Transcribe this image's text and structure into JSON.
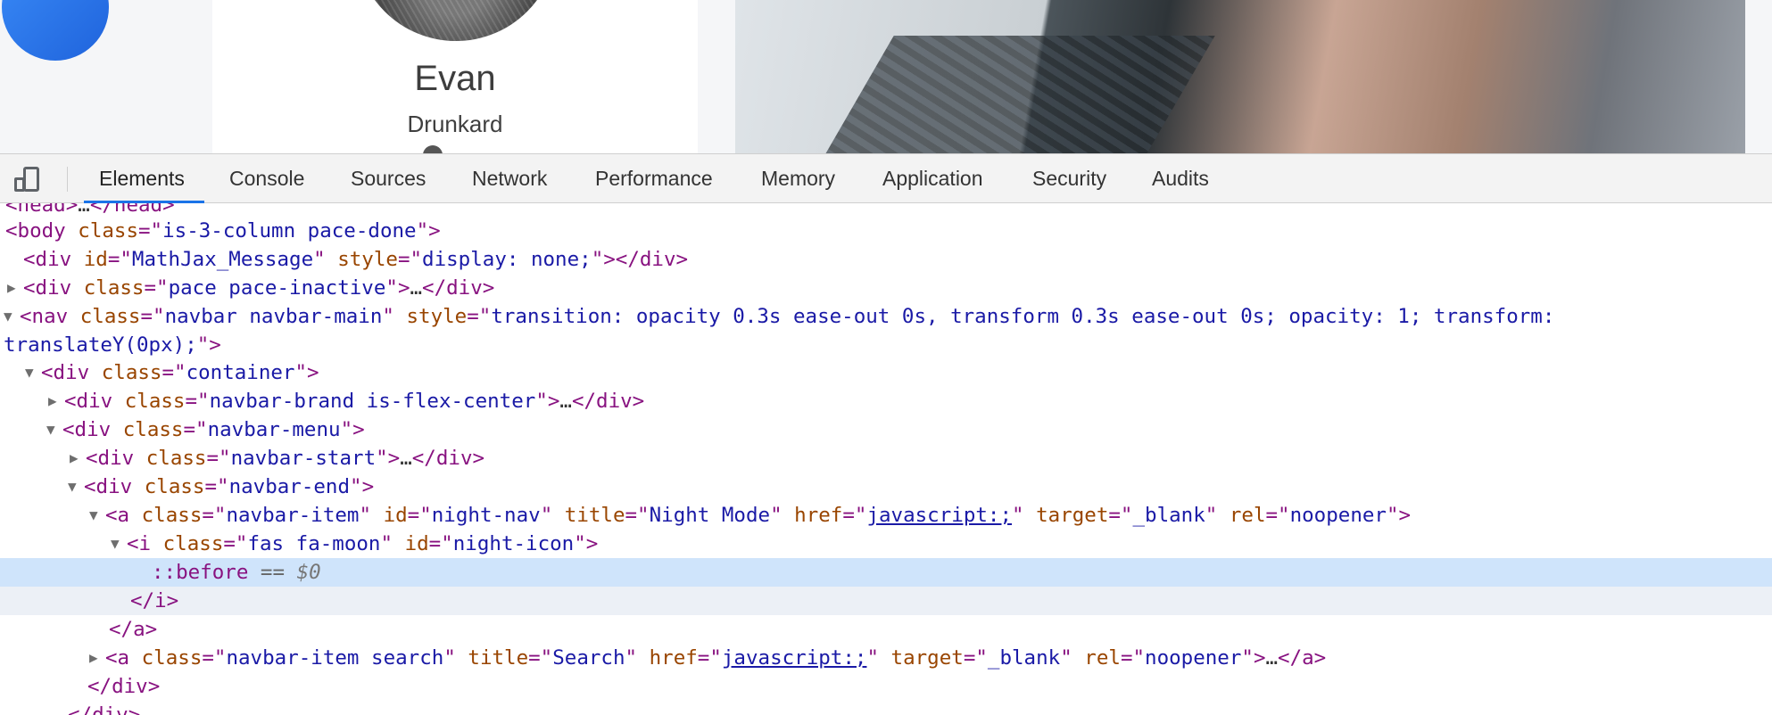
{
  "profile": {
    "name": "Evan",
    "role": "Drunkard"
  },
  "devtools": {
    "tabs": [
      "Elements",
      "Console",
      "Sources",
      "Network",
      "Performance",
      "Memory",
      "Application",
      "Security",
      "Audits"
    ],
    "active_tab": "Elements"
  },
  "dom": {
    "head": {
      "open": "<head>",
      "ellipsis": "…",
      "close": "</head>"
    },
    "body": {
      "open": "<body",
      "attr": "class",
      "val": "is-3-column  pace-done",
      "end": ">"
    },
    "mathjax": {
      "open": "<div",
      "a1": "id",
      "v1": "MathJax_Message",
      "a2": "style",
      "v2": "display: none;",
      "end": "></div>"
    },
    "pace": {
      "open": "<div",
      "attr": "class",
      "val": "pace  pace-inactive",
      "end": ">",
      "ellipsis": "…",
      "close": "</div>"
    },
    "nav": {
      "open": "<nav",
      "a1": "class",
      "v1": "navbar navbar-main",
      "a2": "style",
      "v2a": "transition: opacity 0.3s ease-out 0s, transform 0.3s ease-out 0s; opacity: 1; transform:",
      "v2b": "translateY(0px);",
      "end": ">"
    },
    "container": {
      "open": "<div",
      "attr": "class",
      "val": "container",
      "end": ">"
    },
    "brand": {
      "open": "<div",
      "attr": "class",
      "val": "navbar-brand is-flex-center",
      "end": ">",
      "ellipsis": "…",
      "close": "</div>"
    },
    "menu": {
      "open": "<div",
      "attr": "class",
      "val": "navbar-menu",
      "end": ">"
    },
    "start": {
      "open": "<div",
      "attr": "class",
      "val": "navbar-start",
      "end": ">",
      "ellipsis": "…",
      "close": "</div>"
    },
    "end_div": {
      "open": "<div",
      "attr": "class",
      "val": "navbar-end",
      "end": ">"
    },
    "night_link": {
      "open": "<a",
      "a1": "class",
      "v1": "navbar-item",
      "a2": "id",
      "v2": "night-nav",
      "a3": "title",
      "v3": "Night Mode",
      "a4": "href",
      "v4": "javascript:;",
      "a5": "target",
      "v5": "_blank",
      "a6": "rel",
      "v6": "noopener",
      "end": ">"
    },
    "icon": {
      "open": "<i",
      "a1": "class",
      "v1": "fas fa-moon",
      "a2": "id",
      "v2": "night-icon",
      "end": ">"
    },
    "before": {
      "pseudo": "::before",
      "eq": "==",
      "ref": "$0"
    },
    "icon_close": "</i>",
    "a_close": "</a>",
    "search_link": {
      "open": "<a",
      "a1": "class",
      "v1": "navbar-item search",
      "a2": "title",
      "v2": "Search",
      "a3": "href",
      "v3": "javascript:;",
      "a4": "target",
      "v4": "_blank",
      "a5": "rel",
      "v5": "noopener",
      "end": ">",
      "ellipsis": "…",
      "close": "</a>"
    },
    "end_div_close": "</div>",
    "menu_close": "</div>"
  }
}
